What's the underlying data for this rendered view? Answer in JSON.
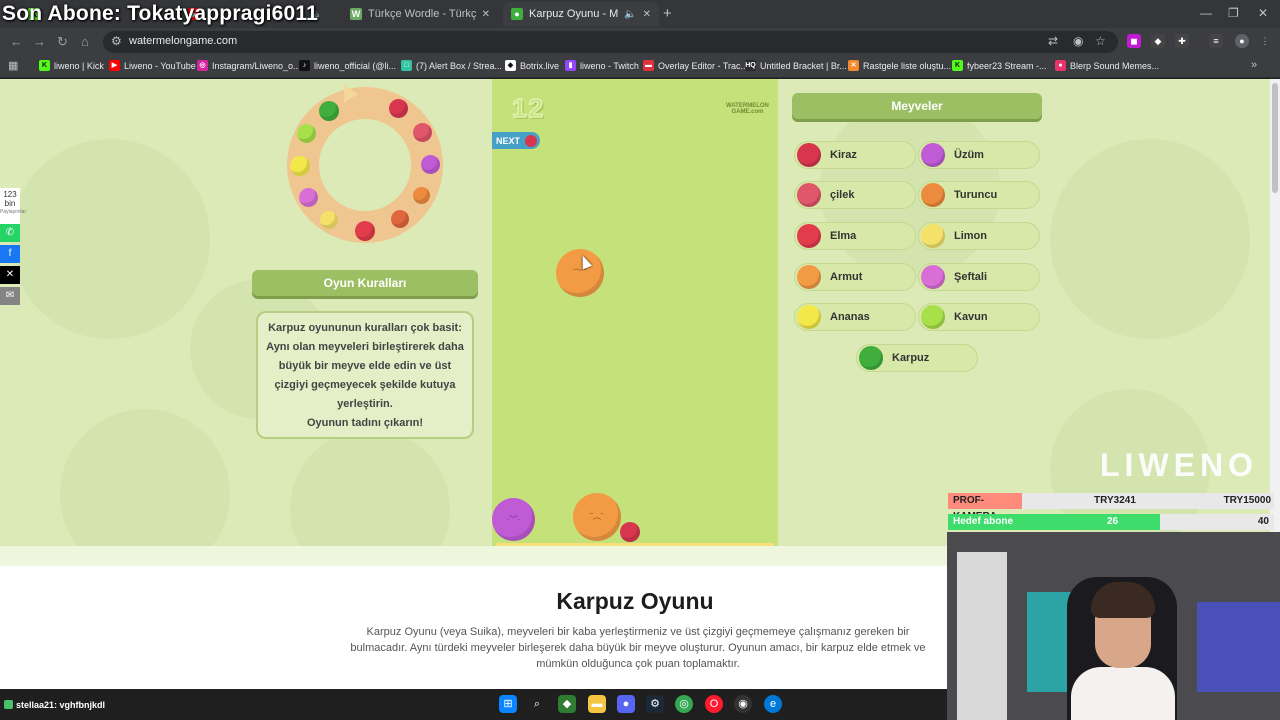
{
  "stream_overlay_title": "Son Abone: Tokatyappragi6011",
  "tabs": [
    {
      "title": "",
      "favicon": "kick-icon"
    },
    {
      "title": "",
      "favicon": "youtube-icon"
    },
    {
      "title": "Türkçe Wordle - Türkçe Kelime",
      "favicon": "wordle-icon"
    },
    {
      "title": "Karpuz Oyunu - Meyveleri B",
      "favicon": "watermelon-icon"
    }
  ],
  "address_bar": {
    "url": "watermelongame.com"
  },
  "bookmarks": [
    {
      "label": "liweno | Kick",
      "color": "#53fc18",
      "glyph": "K"
    },
    {
      "label": "Liweno - YouTube",
      "color": "#ff0000",
      "glyph": "▶"
    },
    {
      "label": "Instagram/Liweno_o...",
      "color": "#d6249f",
      "glyph": "◎"
    },
    {
      "label": "liweno_official (@li...",
      "color": "#111111",
      "glyph": "♪"
    },
    {
      "label": "(7) Alert Box / Strea...",
      "color": "#31c3a2",
      "glyph": "□"
    },
    {
      "label": "Botrix.live",
      "color": "#ffffff",
      "glyph": "◆"
    },
    {
      "label": "liweno - Twitch",
      "color": "#9146ff",
      "glyph": "▮"
    },
    {
      "label": "Overlay Editor - Trac...",
      "color": "#e0323c",
      "glyph": "▬"
    },
    {
      "label": "Untitled Bracket | Br...",
      "color": "#2a2a2a",
      "glyph": "HQ"
    },
    {
      "label": "Rastgele liste oluştu...",
      "color": "#f28a2e",
      "glyph": "✕"
    },
    {
      "label": "fybeer23 Stream -...",
      "color": "#53fc18",
      "glyph": "K"
    },
    {
      "label": "Blerp Sound Memes...",
      "color": "#e8336b",
      "glyph": "●"
    }
  ],
  "share": {
    "count": "123",
    "unit": "bin",
    "sub": "Paylaşımlar"
  },
  "rules": {
    "title": "Oyun Kuralları",
    "lines": [
      "Karpuz oyununun kuralları çok basit:",
      "Aynı olan meyveleri birleştirerek daha",
      "büyük bir meyve elde edin ve üst",
      "çizgiyi geçmeyecek şekilde kutuya",
      "yerleştirin.",
      "Oyunun tadını çıkarın!"
    ]
  },
  "game": {
    "score": "12",
    "next_label": "NEXT",
    "logo_line1": "WATERMELON",
    "logo_line2": "GAME.com"
  },
  "fruits_panel": {
    "title": "Meyveler",
    "items": [
      {
        "label": "Kiraz",
        "color": "#d8364f"
      },
      {
        "label": "Üzüm",
        "color": "#c05bd6"
      },
      {
        "label": "çilek",
        "color": "#e0566a"
      },
      {
        "label": "Turuncu",
        "color": "#ec8a3e"
      },
      {
        "label": "Elma",
        "color": "#e23b4b"
      },
      {
        "label": "Limon",
        "color": "#f4e16a"
      },
      {
        "label": "Armut",
        "color": "#f29b44"
      },
      {
        "label": "Şeftali",
        "color": "#d96fd6"
      },
      {
        "label": "Ananas",
        "color": "#f2e84a"
      },
      {
        "label": "Kavun",
        "color": "#a8e04a"
      },
      {
        "label": "Karpuz",
        "color": "#3fae3c"
      }
    ]
  },
  "watermark": "LIWENO",
  "article": {
    "heading": "Karpuz Oyunu",
    "line1": "Karpuz Oyunu (veya Suika), meyveleri bir kaba yerleştirmeniz ve üst çizgiyi geçmemeye çalışmanız gereken bir",
    "line2": "bulmacadır. Aynı türdeki meyveler birleşerek daha büyük bir meyve oluşturur. Oyunun amacı, bir karpuz elde etmek ve",
    "line3": "mümkün olduğunca çok puan toplamaktır."
  },
  "stats": {
    "camera_label": "PROF-KAMERA",
    "camera_mid": "TRY3241",
    "camera_right": "TRY15000",
    "sub_label": "Hedef abone",
    "sub_current": "26",
    "sub_target": "40",
    "sub_progress": 0.65
  },
  "chat": {
    "user": "stellaa21",
    "message": ": vghfbnjkdl"
  },
  "colors": {
    "page_bg": "#dbeab6",
    "game_bg": "#c5e17a",
    "banner": "#9dbf63",
    "ring": "#f0c690"
  }
}
